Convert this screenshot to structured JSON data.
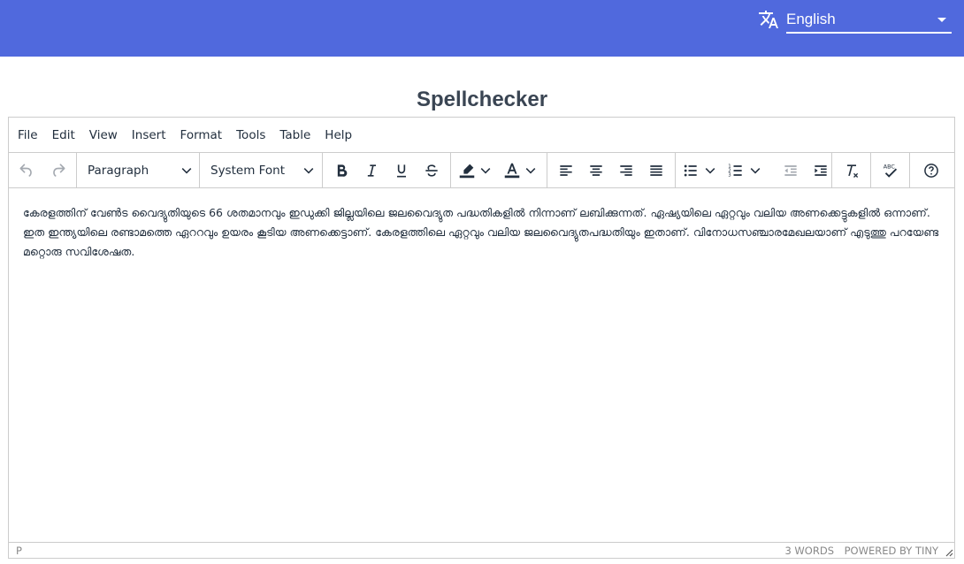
{
  "header": {
    "language": "English",
    "colors": {
      "bar": "#5069dd",
      "text": "#ffffff"
    }
  },
  "page": {
    "title": "Spellchecker"
  },
  "editor": {
    "menu": [
      "File",
      "Edit",
      "View",
      "Insert",
      "Format",
      "Tools",
      "Table",
      "Help"
    ],
    "toolbar": {
      "block_format": "Paragraph",
      "font_family": "System Font",
      "icons": [
        "undo-icon",
        "redo-icon",
        "bold-icon",
        "italic-icon",
        "underline-icon",
        "strikethrough-icon",
        "highlight-color-icon",
        "text-color-icon",
        "align-left-icon",
        "align-center-icon",
        "align-right-icon",
        "align-justify-icon",
        "bullet-list-icon",
        "numbered-list-icon",
        "outdent-icon",
        "indent-icon",
        "clear-formatting-icon",
        "spellcheck-icon",
        "help-icon"
      ]
    },
    "content": "കേരളത്തിന് വേൺട വൈദ്യുതിയുടെ 66 ശതമാനവും ഇഡുക്കി ജില്ലയിലെ ജലവൈദ്യുത പദ്ധതികളിൽ നിന്നാണ് ലബിക്കുന്നത്. ഏഷ്യയിലെ ഏറ്റവും വലിയ അണക്കെട്ടുകളിൽ ഒന്നാണ്. ഇത ഇന്ത്യയിലെ രണ്ടാമത്തെ ഏററവും ഉയരം കൂടിയ അണക്കെട്ടാണ്. കേരളത്തിലെ ഏറ്റവും വലിയ ജലവൈദ്യുതപദ്ധതിയും ഇതാണ്. വിനോധസഞ്ചാരമേഖലയാണ് എടുത്തു പറയേണ്ട മറ്റൊരു സവിശേഷത.",
    "status": {
      "path": "P",
      "word_count": "3 WORDS",
      "branding": "POWERED BY TINY"
    }
  }
}
